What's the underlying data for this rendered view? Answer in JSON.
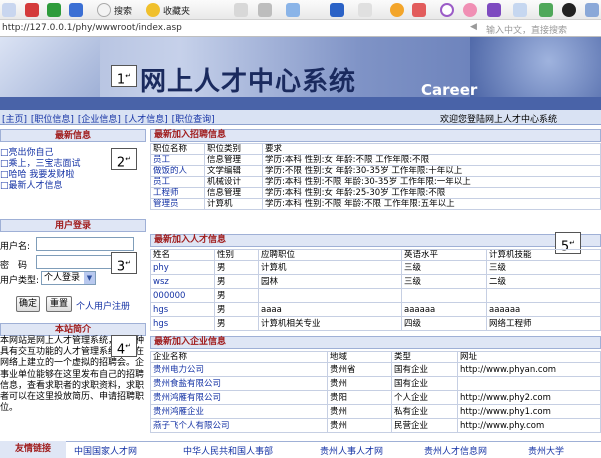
{
  "browser": {
    "toolbar_items": [
      {
        "icon": "close-icon",
        "color": "#d43b3b"
      },
      {
        "icon": "refresh-icon",
        "color": "#2e9b3b"
      },
      {
        "icon": "home-icon",
        "color": "#3b6fd4"
      },
      {
        "icon": "search-icon",
        "label": "搜索"
      },
      {
        "icon": "favorites-star-icon",
        "label": "收藏夹"
      }
    ],
    "address": "http://127.0.0.1/phy/wwwroot/index.asp",
    "search_placeholder": "输入中文，直接搜索"
  },
  "banner": {
    "title": "网上人才中心系统",
    "career": "Career",
    "accent": "#4963a8"
  },
  "nav": {
    "links": [
      "[主页]",
      "[职位信息]",
      "[企业信息]",
      "[人才信息]",
      "[职位查询]"
    ],
    "welcome": "欢迎您登陆网上人才中心系统"
  },
  "annotations": [
    "1",
    "2",
    "3",
    "4",
    "5"
  ],
  "latest_info": {
    "title": "最新信息",
    "items": [
      "亮出你自己",
      "乘上，三宝志面试",
      "哈哈 我要发财啦",
      "最新人才信息"
    ]
  },
  "login": {
    "title": "用户登录",
    "username_label": "用户名:",
    "password_label": "密　码",
    "type_label": "用户类型:",
    "type_value": "个人登录",
    "confirm": "确定",
    "reset": "重置",
    "register": "个人用户注册"
  },
  "intro": {
    "title": "本站简介",
    "text": "本网站是网上人才管理系统，是一种具有交互功能的人才管理系统，是在网络上建立的一个虚拟的招聘会。企事业单位能够在这里发布自己的招聘信息，查看求职者的求职资料，求职者可以在这里投放简历、申请招聘职位。"
  },
  "jobs": {
    "title": "最新加入招聘信息",
    "headers": [
      "职位名称",
      "职位类别",
      "要求"
    ],
    "rows": [
      [
        "员工",
        "信息管理",
        "学历:本科   性别:女  年龄:不限  工作年限:不限"
      ],
      [
        "做饭的人",
        "文学编辑",
        "学历:不限  性别:女  年龄:30-35岁  工作年限:十年以上"
      ],
      [
        "员工",
        "机械设计",
        "学历:本科   性别:不限  年龄:30-35岁  工作年限:一年以上"
      ],
      [
        "工程师",
        "信息管理",
        "学历:本科   性别:女  年龄:25-30岁  工作年限:不限"
      ],
      [
        "管理员",
        "计算机",
        "学历:本科   性别:不限  年龄:不限  工作年限:五年以上"
      ]
    ]
  },
  "talents": {
    "title": "最新加入人才信息",
    "headers": [
      "姓名",
      "性别",
      "应聘职位",
      "英语水平",
      "计算机技能"
    ],
    "rows": [
      [
        "phy",
        "男",
        "计算机",
        "三级",
        "三级"
      ],
      [
        "wsz",
        "男",
        "园林",
        "三级",
        "二级"
      ],
      [
        "000000",
        "男",
        "",
        "",
        ""
      ],
      [
        "hgs",
        "男",
        "aaaa",
        "aaaaaa",
        "aaaaaa"
      ],
      [
        "hgs",
        "男",
        "计算机相关专业",
        "四级",
        "网络工程师"
      ]
    ]
  },
  "companies": {
    "title": "最新加入企业信息",
    "headers": [
      "企业名称",
      "地域",
      "类型",
      "网址"
    ],
    "rows": [
      [
        "贵州电力公司",
        "贵州省",
        "国有企业",
        "http://www.phyan.com"
      ],
      [
        "贵州食盐有限公司",
        "贵州",
        "国有企业",
        ""
      ],
      [
        "贵州鸿雁有限公司",
        "贵阳",
        "个人企业",
        "http://www.phy2.com"
      ],
      [
        "贵州鸿雁企业",
        "贵州",
        "私有企业",
        "http://www.phy1.com"
      ],
      [
        "燕子飞个人有限公司",
        "贵州",
        "民营企业",
        "http://www.phy.com"
      ]
    ]
  },
  "footer": {
    "label": "友情链接",
    "links": [
      "中国国家人才网",
      "中华人民共和国人事部",
      "贵州人事人才网",
      "贵州人才信息网",
      "贵州大学"
    ]
  }
}
